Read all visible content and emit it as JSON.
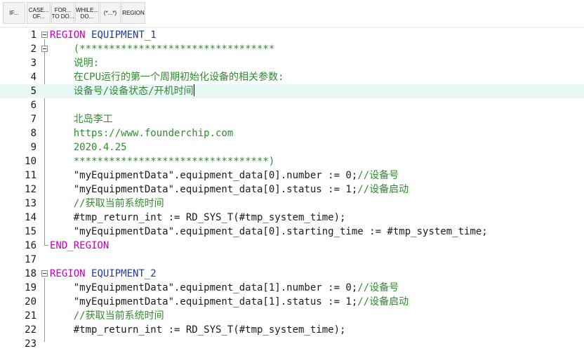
{
  "toolbar": {
    "buttons": [
      {
        "l1": "IF...",
        "l2": ""
      },
      {
        "l1": "CASE...",
        "l2": "OF..."
      },
      {
        "l1": "FOR...",
        "l2": "TO DO..."
      },
      {
        "l1": "WHILE...",
        "l2": "DO..."
      },
      {
        "l1": "(*...*)",
        "l2": ""
      },
      {
        "l1": "REGION",
        "l2": ""
      }
    ]
  },
  "editor": {
    "lines": [
      {
        "n": "1",
        "kw": "REGION ",
        "id": "EQUIPMENT_1"
      },
      {
        "n": "2",
        "cm": "    (*********************************"
      },
      {
        "n": "3",
        "cm": "    说明:"
      },
      {
        "n": "4",
        "cm": "    在CPU运行的第一个周期初始化设备的相关参数:"
      },
      {
        "n": "5",
        "cm": "    设备号/设备状态/开机时间"
      },
      {
        "n": "6",
        "cm": ""
      },
      {
        "n": "7",
        "cm": "    北岛李工"
      },
      {
        "n": "8",
        "cm": "    https://www.founderchip.com"
      },
      {
        "n": "9",
        "cm": "    2020.4.25"
      },
      {
        "n": "10",
        "cm": "    *********************************)"
      },
      {
        "n": "11",
        "st": "    \"myEquipmentData\".equipment_data[0].number := 0;",
        "cm": "//设备号"
      },
      {
        "n": "12",
        "st": "    \"myEquipmentData\".equipment_data[0].status := 1;",
        "cm": "//设备启动"
      },
      {
        "n": "13",
        "cm": "    //获取当前系统时间"
      },
      {
        "n": "14",
        "st": "    #tmp_return_int := RD_SYS_T(#tmp_system_time);"
      },
      {
        "n": "15",
        "st": "    \"myEquipmentData\".equipment_data[0].starting_time := #tmp_system_time;"
      },
      {
        "n": "16",
        "kw": "END_REGION"
      },
      {
        "n": "17"
      },
      {
        "n": "18",
        "kw": "REGION ",
        "id": "EQUIPMENT_2"
      },
      {
        "n": "19",
        "st": "    \"myEquipmentData\".equipment_data[1].number := 0;",
        "cm": "//设备号"
      },
      {
        "n": "20",
        "st": "    \"myEquipmentData\".equipment_data[1].status := 1;",
        "cm": "//设备启动"
      },
      {
        "n": "21",
        "cm": "    //获取当前系统时间"
      },
      {
        "n": "22",
        "st": "    #tmp_return_int := RD_SYS_T(#tmp_system_time);"
      },
      {
        "n": "23"
      }
    ]
  }
}
